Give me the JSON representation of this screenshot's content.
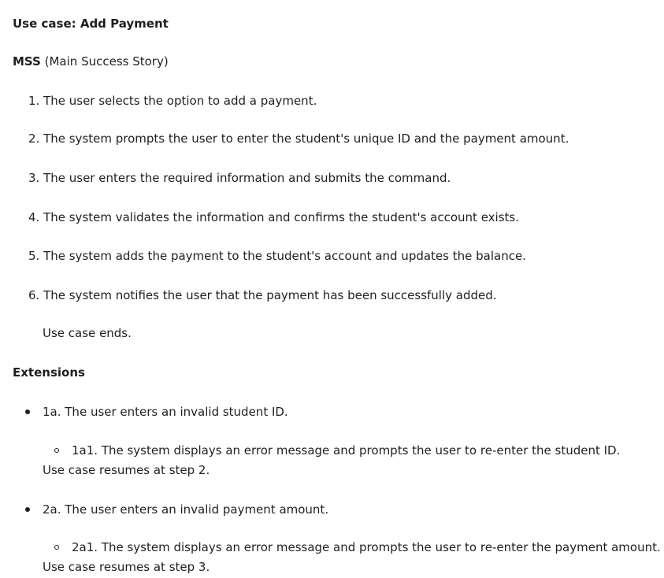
{
  "use_case_title": "Use case: Add Payment",
  "mss": {
    "label": "MSS",
    "subtitle": "(Main Success Story)",
    "steps": [
      "1. The user selects the option to add a payment.",
      "2. The system prompts the user to enter the student's unique ID and the payment amount.",
      "3. The user enters the required information and submits the command.",
      "4. The system validates the information and confirms the student's account exists.",
      "5. The system adds the payment to the student's account and updates the balance.",
      "6. The system notifies the user that the payment has been successfully added."
    ],
    "end_text": "Use case ends."
  },
  "extensions": {
    "heading": "Extensions",
    "items": [
      {
        "text": "1a. The user enters an invalid student ID.",
        "sub": "1a1. The system displays an error message and prompts the user to re-enter the student ID.",
        "resume": "Use case resumes at step 2."
      },
      {
        "text": "2a. The user enters an invalid payment amount.",
        "sub": "2a1. The system displays an error message and prompts the user to re-enter the payment amount.",
        "resume": "Use case resumes at step 3."
      }
    ]
  }
}
